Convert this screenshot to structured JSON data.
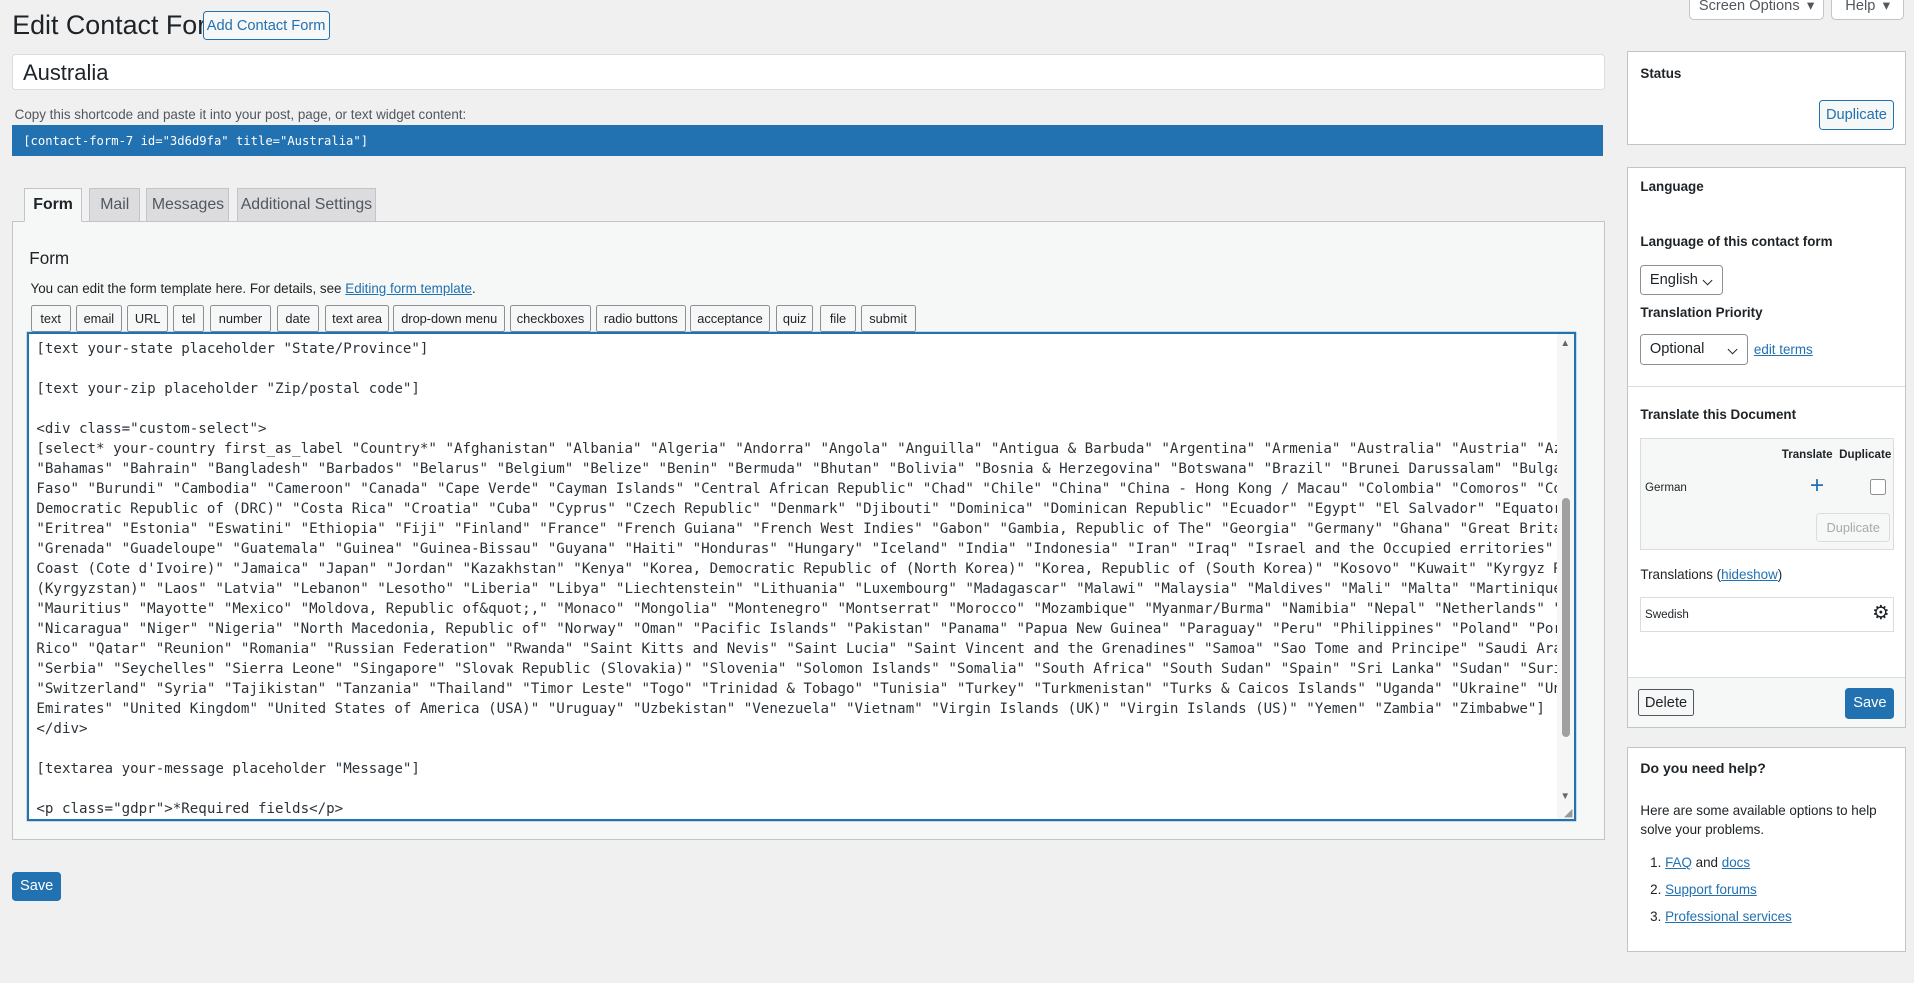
{
  "header": {
    "title": "Edit Contact Form",
    "add_button": "Add Contact Form",
    "screen_options": "Screen Options",
    "help": "Help"
  },
  "form_title": {
    "value": "Australia"
  },
  "shortcode": {
    "label": "Copy this shortcode and paste it into your post, page, or text widget content:",
    "value": "[contact-form-7 id=\"3d6d9fa\" title=\"Australia\"]"
  },
  "tabs": [
    {
      "label": "Form",
      "active": true
    },
    {
      "label": "Mail"
    },
    {
      "label": "Messages"
    },
    {
      "label": "Additional Settings"
    }
  ],
  "form_panel": {
    "heading": "Form",
    "desc": "You can edit the form template here. For details, see ",
    "desc_link": "Editing form template",
    "desc_end": ".",
    "tag_buttons": [
      "text",
      "email",
      "URL",
      "tel",
      "number",
      "date",
      "text area",
      "drop-down menu",
      "checkboxes",
      "radio buttons",
      "acceptance",
      "quiz",
      "file",
      "submit"
    ],
    "template_lines": [
      "[text your-state placeholder \"State/Province\"]",
      "",
      "[text your-zip placeholder \"Zip/postal code\"]",
      "",
      "<div class=\"custom-select\">",
      "[select* your-country first_as_label \"Country*\" \"Afghanistan\" \"Albania\" \"Algeria\" \"Andorra\" \"Angola\" \"Anguilla\" \"Antigua & Barbuda\" \"Argentina\" \"Armenia\" \"Australia\" \"Austria\" \"Azerbaijan\"",
      "\"Bahamas\" \"Bahrain\" \"Bangladesh\" \"Barbados\" \"Belarus\" \"Belgium\" \"Belize\" \"Benin\" \"Bermuda\" \"Bhutan\" \"Bolivia\" \"Bosnia & Herzegovina\" \"Botswana\" \"Brazil\" \"Brunei Darussalam\" \"Bulgaria\" \"Burkina",
      "Faso\" \"Burundi\" \"Cambodia\" \"Cameroon\" \"Canada\" \"Cape Verde\" \"Cayman Islands\" \"Central African Republic\" \"Chad\" \"Chile\" \"China\" \"China - Hong Kong / Macau\" \"Colombia\" \"Comoros\" \"Congo\" \"Congo,",
      "Democratic Republic of (DRC)\" \"Costa Rica\" \"Croatia\" \"Cuba\" \"Cyprus\" \"Czech Republic\" \"Denmark\" \"Djibouti\" \"Dominica\" \"Dominican Republic\" \"Ecuador\" \"Egypt\" \"El Salvador\" \"Equatorial Guinea\"",
      "\"Eritrea\" \"Estonia\" \"Eswatini\" \"Ethiopia\" \"Fiji\" \"Finland\" \"France\" \"French Guiana\" \"French West Indies\" \"Gabon\" \"Gambia, Republic of The\" \"Georgia\" \"Germany\" \"Ghana\" \"Great Britain\" \"Greece\"",
      "\"Grenada\" \"Guadeloupe\" \"Guatemala\" \"Guinea\" \"Guinea-Bissau\" \"Guyana\" \"Haiti\" \"Honduras\" \"Hungary\" \"Iceland\" \"India\" \"Indonesia\" \"Iran\" \"Iraq\" \"Israel and the Occupied erritories\" \"Italy\" \"Ivory",
      "Coast (Cote d'Ivoire)\" \"Jamaica\" \"Japan\" \"Jordan\" \"Kazakhstan\" \"Kenya\" \"Korea, Democratic Republic of (North Korea)\" \"Korea, Republic of (South Korea)\" \"Kosovo\" \"Kuwait\" \"Kyrgyz Republic",
      "(Kyrgyzstan)\" \"Laos\" \"Latvia\" \"Lebanon\" \"Lesotho\" \"Liberia\" \"Libya\" \"Liechtenstein\" \"Lithuania\" \"Luxembourg\" \"Madagascar\" \"Malawi\" \"Malaysia\" \"Maldives\" \"Mali\" \"Malta\" \"Martinique\" \"Mauritania\"",
      "\"Mauritius\" \"Mayotte\" \"Mexico\" \"Moldova, Republic of&quot;,\" \"Monaco\" \"Mongolia\" \"Montenegro\" \"Montserrat\" \"Morocco\" \"Mozambique\" \"Myanmar/Burma\" \"Namibia\" \"Nepal\" \"Netherlands\" \"New Zealand\"",
      "\"Nicaragua\" \"Niger\" \"Nigeria\" \"North Macedonia, Republic of\" \"Norway\" \"Oman\" \"Pacific Islands\" \"Pakistan\" \"Panama\" \"Papua New Guinea\" \"Paraguay\" \"Peru\" \"Philippines\" \"Poland\" \"Portugal\" \"Puerto",
      "Rico\" \"Qatar\" \"Reunion\" \"Romania\" \"Russian Federation\" \"Rwanda\" \"Saint Kitts and Nevis\" \"Saint Lucia\" \"Saint Vincent and the Grenadines\" \"Samoa\" \"Sao Tome and Principe\" \"Saudi Arabia\" \"Senegal\"",
      "\"Serbia\" \"Seychelles\" \"Sierra Leone\" \"Singapore\" \"Slovak Republic (Slovakia)\" \"Slovenia\" \"Solomon Islands\" \"Somalia\" \"South Africa\" \"South Sudan\" \"Spain\" \"Sri Lanka\" \"Sudan\" \"Suriname\" \"Sweden\"",
      "\"Switzerland\" \"Syria\" \"Tajikistan\" \"Tanzania\" \"Thailand\" \"Timor Leste\" \"Togo\" \"Trinidad & Tobago\" \"Tunisia\" \"Turkey\" \"Turkmenistan\" \"Turks & Caicos Islands\" \"Uganda\" \"Ukraine\" \"United Arab",
      "Emirates\" \"United Kingdom\" \"United States of America (USA)\" \"Uruguay\" \"Uzbekistan\" \"Venezuela\" \"Vietnam\" \"Virgin Islands (UK)\" \"Virgin Islands (US)\" \"Yemen\" \"Zambia\" \"Zimbabwe\"]",
      "</div>",
      "",
      "[textarea your-message placeholder \"Message\"]",
      "",
      "<p class=\"gdpr\">*Required fields</p>"
    ]
  },
  "save_label": "Save",
  "status_box": {
    "title": "Status",
    "duplicate": "Duplicate"
  },
  "language_box": {
    "title": "Language",
    "lang_label": "Language of this contact form",
    "lang_value": "English",
    "priority_label": "Translation Priority",
    "priority_value": "Optional",
    "edit_terms": "edit terms",
    "translate_title": "Translate this Document",
    "col_translate": "Translate",
    "col_duplicate": "Duplicate",
    "row_lang": "German",
    "duplicate_btn": "Duplicate",
    "translations_label": "Translations (",
    "translations_link": "hideshow",
    "translations_end": ")",
    "translation_item": "Swedish",
    "delete": "Delete",
    "save": "Save"
  },
  "help_box": {
    "title": "Do you need help?",
    "text": "Here are some available options to help solve your problems.",
    "item1_num": "1.",
    "item1_a": "FAQ",
    "item1_mid": " and ",
    "item1_b": "docs",
    "item2_num": "2.",
    "item2": "Support forums",
    "item3_num": "3.",
    "item3": "Professional services"
  },
  "colors": {
    "accent": "#2271b1",
    "background": "#f0f0f1"
  }
}
